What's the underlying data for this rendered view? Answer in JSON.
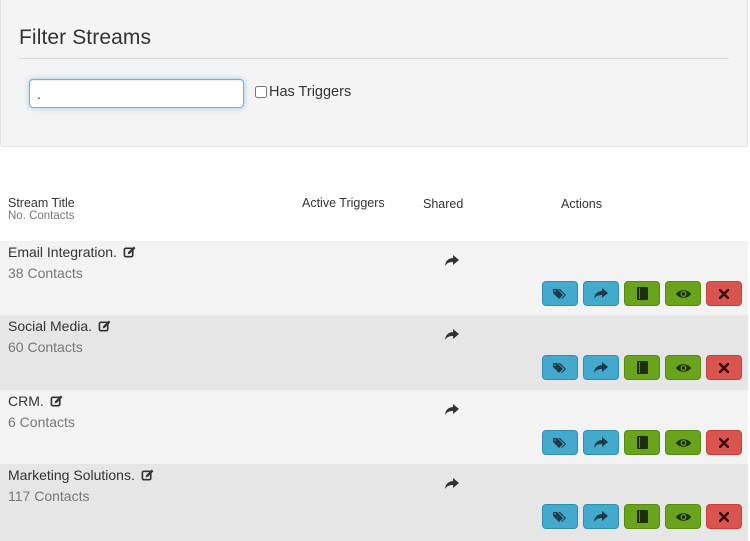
{
  "filter": {
    "title": "Filter Streams",
    "search_value": ".",
    "has_triggers_label": "Has Triggers",
    "has_triggers_checked": false
  },
  "table": {
    "headers": {
      "title": "Stream Title",
      "subtitle": "No. Contacts",
      "triggers": "Active Triggers",
      "shared": "Shared",
      "actions": "Actions"
    },
    "rows": [
      {
        "title": "Email Integration.",
        "contacts": "38 Contacts"
      },
      {
        "title": "Social Media.",
        "contacts": "60 Contacts"
      },
      {
        "title": "CRM.",
        "contacts": "6 Contacts"
      },
      {
        "title": "Marketing Solutions.",
        "contacts": "117 Contacts"
      }
    ],
    "actions": [
      "tags-icon",
      "share-icon",
      "book-icon",
      "eye-icon",
      "delete-icon"
    ]
  },
  "colors": {
    "info": "#43aacd",
    "success": "#6aa31c",
    "danger": "#d9534f",
    "row_odd": "#f3f3f3",
    "row_even": "#e6e6e6"
  }
}
